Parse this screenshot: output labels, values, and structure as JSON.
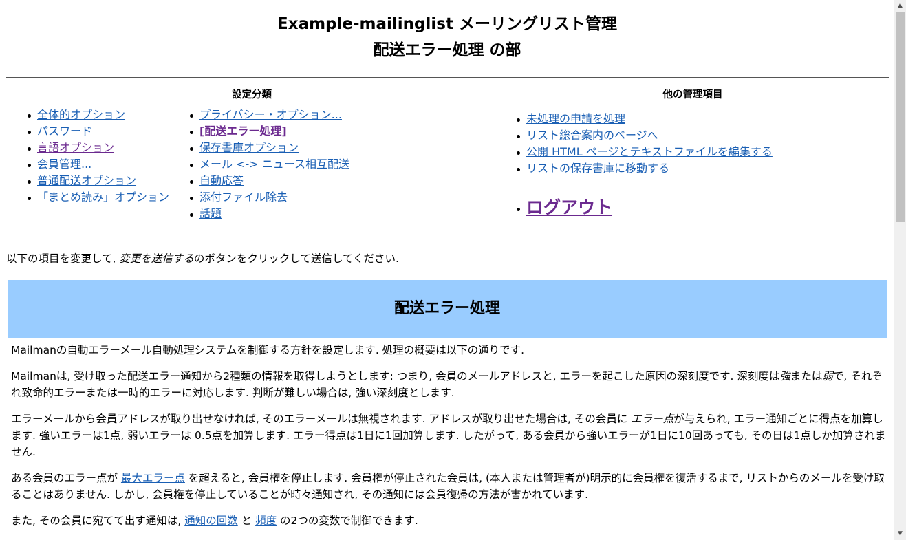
{
  "header": {
    "title_line1": "Example-mailinglist メーリングリスト管理",
    "title_line2": "配送エラー処理 の部"
  },
  "nav": {
    "settings_heading": "設定分類",
    "other_heading": "他の管理項目",
    "col1": [
      "全体的オプション",
      "パスワード",
      "言語オプション",
      "会員管理...",
      "普通配送オプション",
      "「まとめ読み」オプション"
    ],
    "col2": [
      "プライバシー・オプション...",
      "[配送エラー処理]",
      "保存書庫オプション",
      "メール <-> ニュース相互配送",
      "自動応答",
      "添付ファイル除去",
      "話題"
    ],
    "other": [
      "未処理の申請を処理",
      "リスト総合案内のページへ",
      "公開 HTML ページとテキストファイルを編集する",
      "リストの保存書庫に移動する"
    ],
    "logout": "ログアウト"
  },
  "intro": {
    "before": "以下の項目を変更して, ",
    "emph": "変更を送信する",
    "after": "のボタンをクリックして送信してください."
  },
  "section_title": "配送エラー処理",
  "body": {
    "p1": "Mailmanの自動エラーメール自動処理システムを制御する方針を設定します. 処理の概要は以下の通りです.",
    "p2_a": "Mailmanは, 受け取った配送エラー通知から2種類の情報を取得しようとします: つまり, 会員のメールアドレスと, エラーを起こした原因の深刻度です. 深刻度は",
    "p2_strong": "強",
    "p2_b": "または",
    "p2_weak": "弱",
    "p2_c": "で, それぞれ致命的エラーまたは一時的エラーに対応します. 判断が難しい場合は, 強い深刻度とします.",
    "p3_a": "エラーメールから会員アドレスが取り出せなければ, そのエラーメールは無視されます. アドレスが取り出せた場合は, その会員に ",
    "p3_em": "エラー点",
    "p3_b": "が与えられ, エラー通知ごとに得点を加算します. 強いエラーは1点, 弱いエラーは 0.5点を加算します. エラー得点は1日に1回加算します. したがって, ある会員から強いエラーが1日に10回あっても, その日は1点しか加算されません.",
    "p4_a": "ある会員のエラー点が ",
    "p4_link": "最大エラー点",
    "p4_b": " を超えると, 会員権を停止します. 会員権が停止された会員は, (本人または管理者が)明示的に会員権を復活するまで, リストからのメールを受け取ることはありません. しかし, 会員権を停止していることが時々通知され, その通知には会員復帰の方法が書かれています.",
    "p5_a": "また, その会員に宛てて出す通知は, ",
    "p5_link1": "通知の回数",
    "p5_b": " と ",
    "p5_link2": "頻度",
    "p5_c": " の2つの変数で制御できます."
  },
  "scrollbar": {
    "up": "▲",
    "down": "▼"
  }
}
